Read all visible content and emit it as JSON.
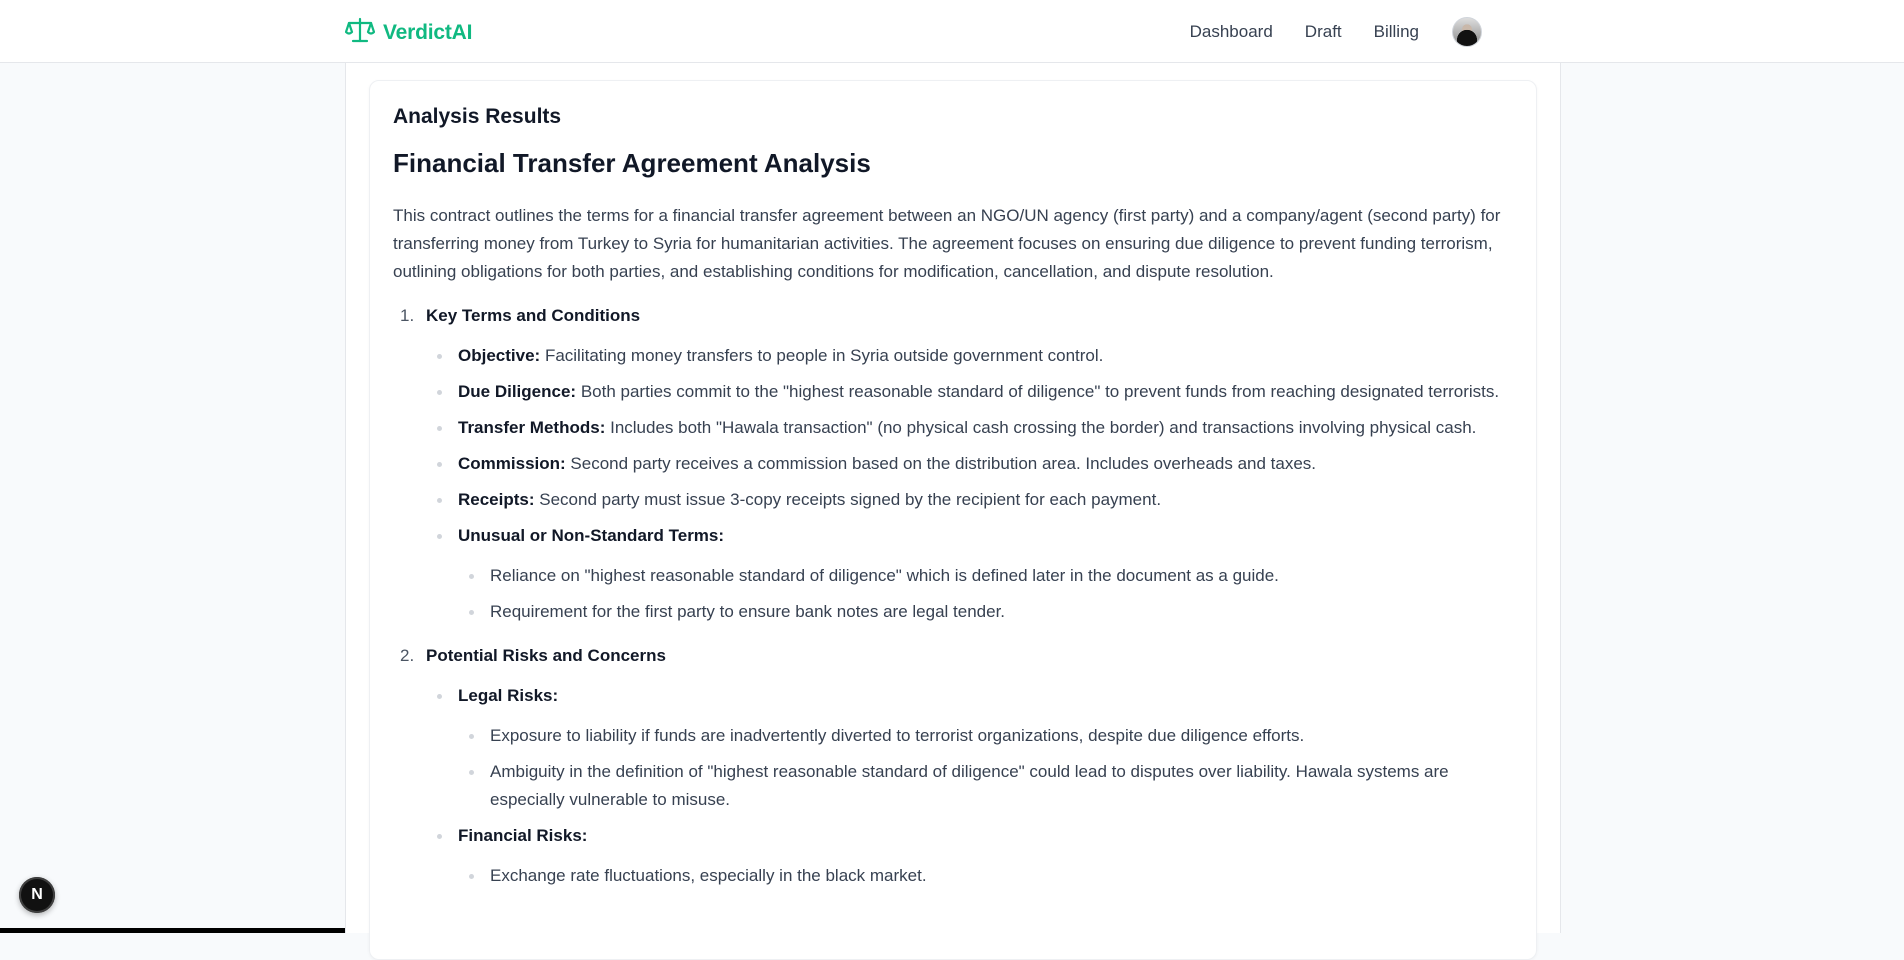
{
  "header": {
    "brand_name": "VerdictAI",
    "nav": [
      "Dashboard",
      "Draft",
      "Billing"
    ],
    "brand_color": "#10b981"
  },
  "results": {
    "section_heading": "Analysis Results",
    "title": "Financial Transfer Agreement Analysis",
    "summary": "This contract outlines the terms for a financial transfer agreement between an NGO/UN agency (first party) and a company/agent (second party) for transferring money from Turkey to Syria for humanitarian activities. The agreement focuses on ensuring due diligence to prevent funding terrorism, outlining obligations for both parties, and establishing conditions for modification, cancellation, and dispute resolution.",
    "sections": [
      {
        "number": "1.",
        "title": "Key Terms and Conditions",
        "items": [
          {
            "label": "Objective:",
            "text": "Facilitating money transfers to people in Syria outside government control."
          },
          {
            "label": "Due Diligence:",
            "text": "Both parties commit to the \"highest reasonable standard of diligence\" to prevent funds from reaching designated terrorists."
          },
          {
            "label": "Transfer Methods:",
            "text": "Includes both \"Hawala transaction\" (no physical cash crossing the border) and transactions involving physical cash."
          },
          {
            "label": "Commission:",
            "text": "Second party receives a commission based on the distribution area. Includes overheads and taxes."
          },
          {
            "label": "Receipts:",
            "text": "Second party must issue 3-copy receipts signed by the recipient for each payment."
          },
          {
            "label": "Unusual or Non-Standard Terms:",
            "text": "",
            "subitems": [
              "Reliance on \"highest reasonable standard of diligence\" which is defined later in the document as a guide.",
              "Requirement for the first party to ensure bank notes are legal tender."
            ]
          }
        ]
      },
      {
        "number": "2.",
        "title": "Potential Risks and Concerns",
        "items": [
          {
            "label": "Legal Risks:",
            "text": "",
            "subitems": [
              "Exposure to liability if funds are inadvertently diverted to terrorist organizations, despite due diligence efforts.",
              "Ambiguity in the definition of \"highest reasonable standard of diligence\" could lead to disputes over liability. Hawala systems are especially vulnerable to misuse."
            ]
          },
          {
            "label": "Financial Risks:",
            "text": "",
            "subitems": [
              "Exchange rate fluctuations, especially in the black market."
            ]
          }
        ]
      }
    ]
  },
  "dev_badge": "N"
}
